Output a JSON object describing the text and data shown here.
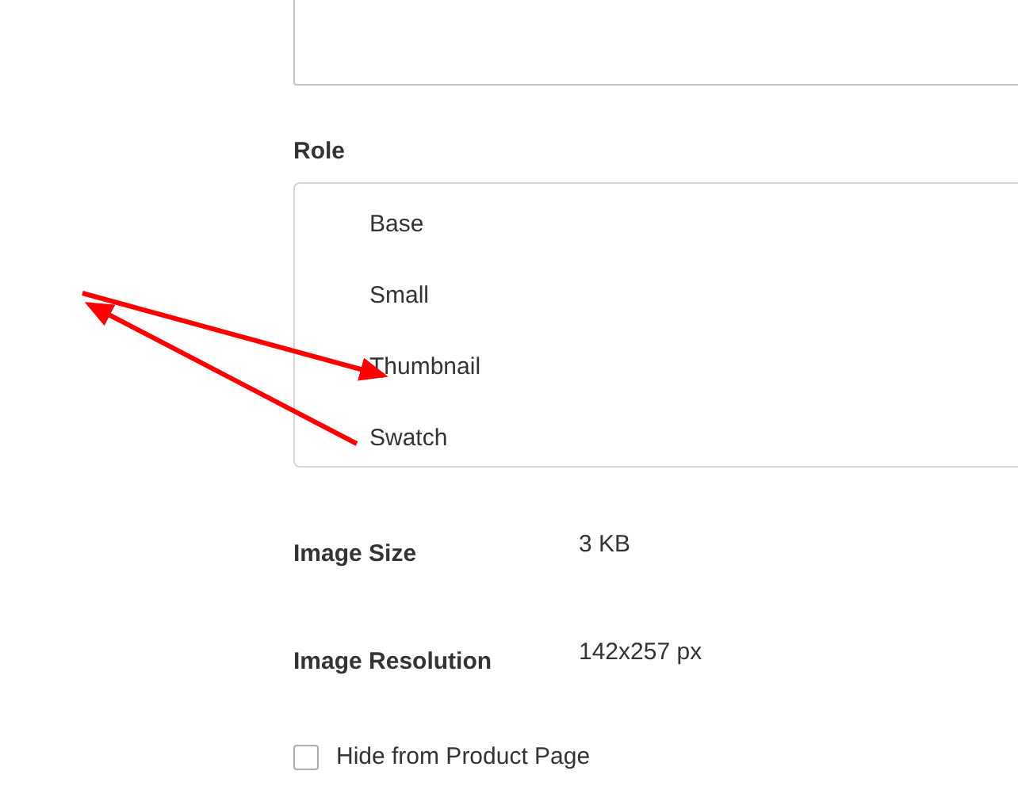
{
  "role": {
    "label": "Role",
    "options": [
      {
        "label": "Base"
      },
      {
        "label": "Small"
      },
      {
        "label": "Thumbnail"
      },
      {
        "label": "Swatch"
      }
    ]
  },
  "details": [
    {
      "label": "Image Size",
      "value": "3 KB"
    },
    {
      "label": "Image Resolution",
      "value": "142x257 px"
    }
  ],
  "hide_from_product_page": {
    "label": "Hide from Product Page",
    "checked": false
  }
}
